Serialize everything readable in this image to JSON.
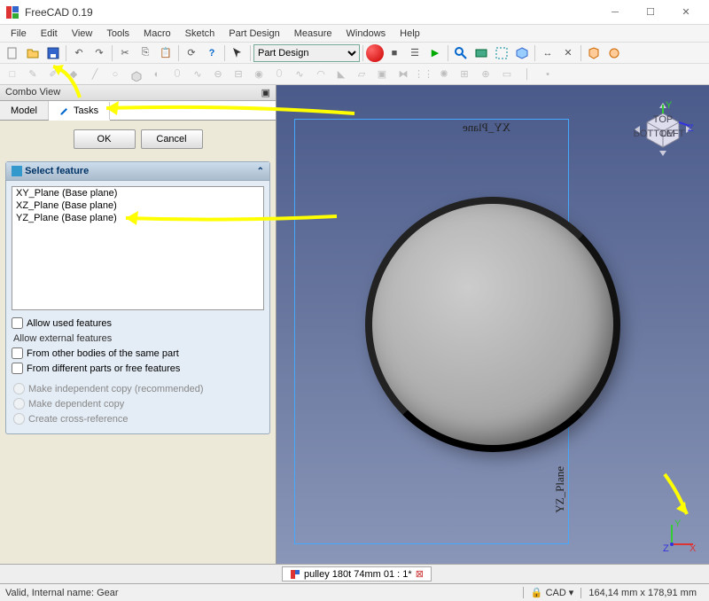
{
  "window": {
    "title": "FreeCAD 0.19"
  },
  "menu": [
    "File",
    "Edit",
    "View",
    "Tools",
    "Macro",
    "Sketch",
    "Part Design",
    "Measure",
    "Windows",
    "Help"
  ],
  "workbench": {
    "selected": "Part Design"
  },
  "combo": {
    "header": "Combo View",
    "tabs": {
      "model": "Model",
      "tasks": "Tasks"
    },
    "ok": "OK",
    "cancel": "Cancel",
    "select_feature": "Select feature",
    "items": [
      {
        "label": "XY_Plane (Base plane)"
      },
      {
        "label": "XZ_Plane (Base plane)"
      },
      {
        "label": "YZ_Plane (Base plane)"
      }
    ],
    "allow_used": "Allow used features",
    "allow_ext_label": "Allow external features",
    "ext_same": "From other bodies of the same part",
    "ext_diff": "From different parts or free features",
    "r1": "Make independent copy (recommended)",
    "r2": "Make dependent copy",
    "r3": "Create cross-reference"
  },
  "viewport": {
    "xy_label": "XY_Plane",
    "yz_label": "YZ_Plane",
    "cube_top": "TOP",
    "cube_left": "LEFT",
    "cube_bottom": "BOTTOM"
  },
  "doc_tab": "pulley 180t 74mm 01 : 1*",
  "status": {
    "left": "Valid, Internal name: Gear",
    "mode": "CAD",
    "coords": "164,14 mm x 178,91 mm"
  }
}
